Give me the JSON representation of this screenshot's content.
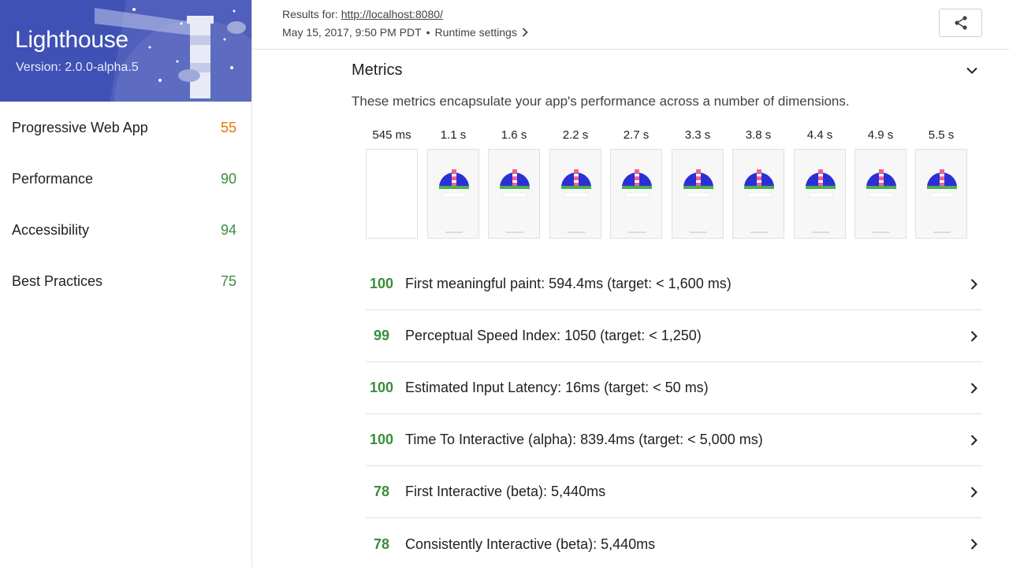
{
  "brand": {
    "title": "Lighthouse",
    "version": "Version: 2.0.0-alpha.5",
    "color": "#3f51b5"
  },
  "sidebar": {
    "items": [
      {
        "label": "Progressive Web App",
        "score": "55",
        "color": "#e67700"
      },
      {
        "label": "Performance",
        "score": "90",
        "color": "#388e3c"
      },
      {
        "label": "Accessibility",
        "score": "94",
        "color": "#388e3c"
      },
      {
        "label": "Best Practices",
        "score": "75",
        "color": "#388e3c"
      }
    ]
  },
  "header": {
    "results_prefix": "Results for:",
    "url": "http://localhost:8080/",
    "date": "May 15, 2017, 9:50 PM PDT",
    "separator": "•",
    "runtime_label": "Runtime settings",
    "runtime_icon": "chevron-right-icon",
    "share_icon": "share-icon"
  },
  "metrics": {
    "title": "Metrics",
    "collapse_icon": "chevron-down-icon",
    "description": "These metrics encapsulate your app's performance across a number of dimensions.",
    "filmstrip": [
      {
        "time": "545 ms",
        "blank": true
      },
      {
        "time": "1.1 s",
        "blank": false
      },
      {
        "time": "1.6 s",
        "blank": false
      },
      {
        "time": "2.2 s",
        "blank": false
      },
      {
        "time": "2.7 s",
        "blank": false
      },
      {
        "time": "3.3 s",
        "blank": false
      },
      {
        "time": "3.8 s",
        "blank": false
      },
      {
        "time": "4.4 s",
        "blank": false
      },
      {
        "time": "4.9 s",
        "blank": false
      },
      {
        "time": "5.5 s",
        "blank": false
      }
    ],
    "audits": [
      {
        "score": "100",
        "text": "First meaningful paint: 594.4ms (target: < 1,600 ms)"
      },
      {
        "score": "99",
        "text": "Perceptual Speed Index: 1050 (target: < 1,250)"
      },
      {
        "score": "100",
        "text": "Estimated Input Latency: 16ms (target: < 50 ms)"
      },
      {
        "score": "100",
        "text": "Time To Interactive (alpha): 839.4ms (target: < 5,000 ms)"
      },
      {
        "score": "78",
        "text": "First Interactive (beta): 5,440ms"
      },
      {
        "score": "78",
        "text": "Consistently Interactive (beta): 5,440ms"
      }
    ],
    "score_color": "#388e3c"
  }
}
